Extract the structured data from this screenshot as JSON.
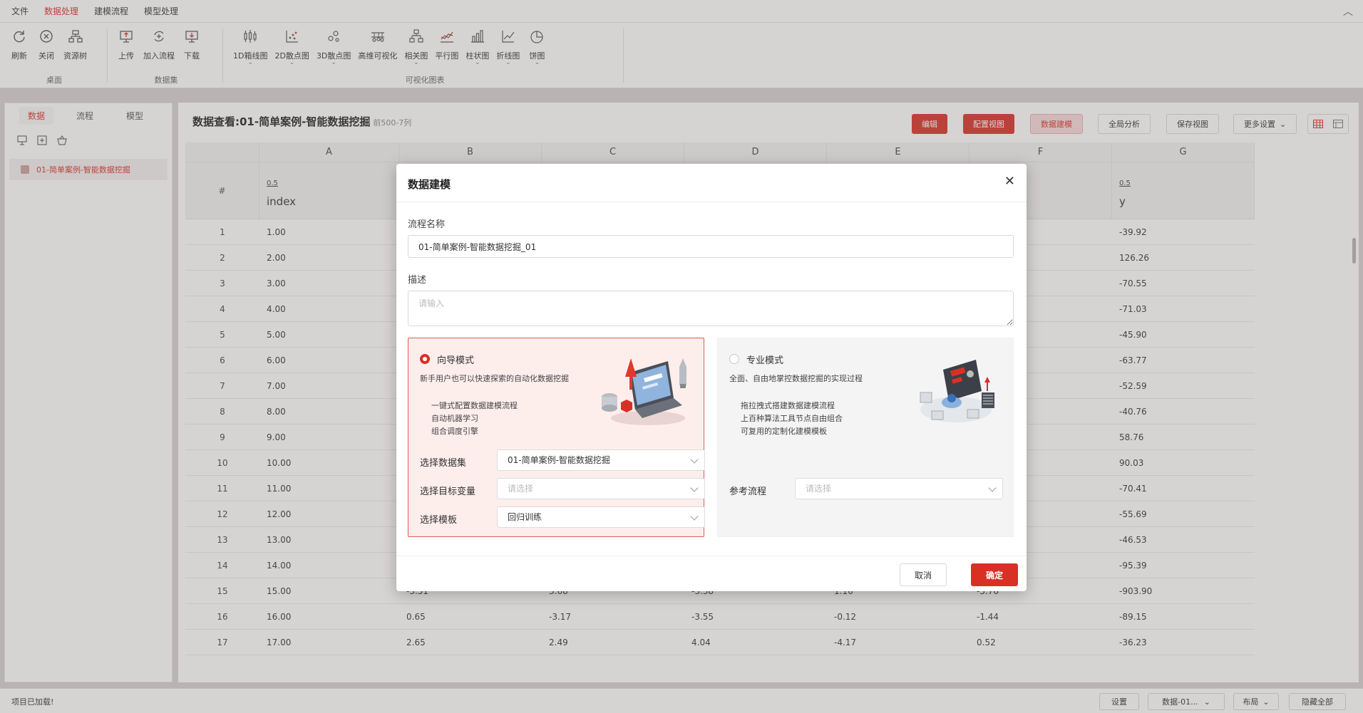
{
  "menu": {
    "items": [
      "文件",
      "数据处理",
      "建模流程",
      "模型处理"
    ],
    "active_index": 1,
    "collapse_glyph": "︿"
  },
  "ribbon": {
    "groups": [
      {
        "name": "桌面",
        "buttons": [
          {
            "label": "刷新",
            "icon": "refresh-icon"
          },
          {
            "label": "关闭",
            "icon": "close-circle-icon"
          },
          {
            "label": "资源树",
            "icon": "resource-tree-icon"
          }
        ]
      },
      {
        "name": "数据集",
        "buttons": [
          {
            "label": "上传",
            "icon": "upload-icon"
          },
          {
            "label": "加入流程",
            "icon": "add-to-flow-icon"
          },
          {
            "label": "下载",
            "icon": "download-icon"
          }
        ]
      },
      {
        "name": "可视化图表",
        "buttons": [
          {
            "label": "1D箱线图",
            "icon": "boxplot-icon",
            "dropdown": true
          },
          {
            "label": "2D散点图",
            "icon": "scatter-2d-icon",
            "dropdown": true
          },
          {
            "label": "3D散点图",
            "icon": "scatter-3d-icon",
            "dropdown": true
          },
          {
            "label": "高维可视化",
            "icon": "high-dim-icon"
          },
          {
            "label": "相关图",
            "icon": "correlation-icon",
            "dropdown": true
          },
          {
            "label": "平行图",
            "icon": "parallel-icon"
          },
          {
            "label": "柱状图",
            "icon": "bar-chart-icon",
            "dropdown": true
          },
          {
            "label": "折线图",
            "icon": "line-chart-icon",
            "dropdown": true
          },
          {
            "label": "饼图",
            "icon": "pie-chart-icon",
            "dropdown": true
          }
        ]
      }
    ]
  },
  "left_panel": {
    "tabs": [
      "数据",
      "流程",
      "模型"
    ],
    "active_tab": 0,
    "tools": [
      "monitor-icon",
      "add-box-icon",
      "basket-icon"
    ],
    "tree_item": "01-简单案例-智能数据挖掘"
  },
  "main": {
    "title": "数据查看:01-简单案例-智能数据挖掘",
    "subtitle": "前500-7列",
    "buttons": {
      "edit": "编辑",
      "config_view": "配置视图",
      "data_model": "数据建模",
      "global_analysis": "全局分析",
      "save_view": "保存视图",
      "more_settings": "更多设置"
    },
    "columns": [
      "A",
      "B",
      "C",
      "D",
      "E",
      "F",
      "G"
    ],
    "hash": "#",
    "field_a": {
      "meta": "0.5",
      "name": "index"
    },
    "field_g": {
      "meta": "0.5",
      "name": "y"
    },
    "rows": [
      {
        "n": "1",
        "a": "1.00",
        "b": "",
        "c": "",
        "d": "",
        "e": "",
        "f": "",
        "g": "-39.92"
      },
      {
        "n": "2",
        "a": "2.00",
        "b": "",
        "c": "",
        "d": "",
        "e": "",
        "f": "",
        "g": "126.26"
      },
      {
        "n": "3",
        "a": "3.00",
        "b": "",
        "c": "",
        "d": "",
        "e": "",
        "f": "",
        "g": "-70.55"
      },
      {
        "n": "4",
        "a": "4.00",
        "b": "",
        "c": "",
        "d": "",
        "e": "",
        "f": "",
        "g": "-71.03"
      },
      {
        "n": "5",
        "a": "5.00",
        "b": "",
        "c": "",
        "d": "",
        "e": "",
        "f": "",
        "g": "-45.90"
      },
      {
        "n": "6",
        "a": "6.00",
        "b": "",
        "c": "",
        "d": "",
        "e": "",
        "f": "",
        "g": "-63.77"
      },
      {
        "n": "7",
        "a": "7.00",
        "b": "",
        "c": "",
        "d": "",
        "e": "",
        "f": "",
        "g": "-52.59"
      },
      {
        "n": "8",
        "a": "8.00",
        "b": "",
        "c": "",
        "d": "",
        "e": "",
        "f": "",
        "g": "-40.76"
      },
      {
        "n": "9",
        "a": "9.00",
        "b": "",
        "c": "",
        "d": "",
        "e": "",
        "f": "",
        "g": "58.76"
      },
      {
        "n": "10",
        "a": "10.00",
        "b": "",
        "c": "",
        "d": "",
        "e": "",
        "f": "",
        "g": "90.03"
      },
      {
        "n": "11",
        "a": "11.00",
        "b": "",
        "c": "",
        "d": "",
        "e": "",
        "f": "",
        "g": "-70.41"
      },
      {
        "n": "12",
        "a": "12.00",
        "b": "",
        "c": "",
        "d": "",
        "e": "",
        "f": "",
        "g": "-55.69"
      },
      {
        "n": "13",
        "a": "13.00",
        "b": "",
        "c": "",
        "d": "",
        "e": "",
        "f": "",
        "g": "-46.53"
      },
      {
        "n": "14",
        "a": "14.00",
        "b": "",
        "c": "",
        "d": "",
        "e": "",
        "f": "",
        "g": "-95.39"
      },
      {
        "n": "15",
        "a": "15.00",
        "b": "-3.51",
        "c": "3.68",
        "d": "-3.38",
        "e": "1.16",
        "f": "-3.76",
        "g": "-903.90"
      },
      {
        "n": "16",
        "a": "16.00",
        "b": "0.65",
        "c": "-3.17",
        "d": "-3.55",
        "e": "-0.12",
        "f": "-1.44",
        "g": "-89.15"
      },
      {
        "n": "17",
        "a": "17.00",
        "b": "2.65",
        "c": "2.49",
        "d": "4.04",
        "e": "-4.17",
        "f": "0.52",
        "g": "-36.23"
      }
    ]
  },
  "status": {
    "text": "项目已加载!",
    "buttons": {
      "settings": "设置",
      "dataset": "数据-01...",
      "layout": "布局",
      "hide_all": "隐藏全部"
    }
  },
  "modal": {
    "title": "数据建模",
    "close_glyph": "✕",
    "flow_name_label": "流程名称",
    "flow_name_value": "01-简单案例-智能数据挖掘_01",
    "desc_label": "描述",
    "desc_placeholder": "请输入",
    "guide": {
      "title": "向导模式",
      "desc": "新手用户也可以快速探索的自动化数据挖掘",
      "features": [
        "一键式配置数据建模流程",
        "自动机器学习",
        "组合调度引擎"
      ],
      "dataset_label": "选择数据集",
      "dataset_value": "01-简单案例-智能数据挖掘",
      "target_label": "选择目标变量",
      "target_placeholder": "请选择",
      "template_label": "选择模板",
      "template_value": "回归训练"
    },
    "pro": {
      "title": "专业模式",
      "desc": "全面、自由地掌控数据挖掘的实现过程",
      "features": [
        "拖拉拽式搭建数据建模流程",
        "上百种算法工具节点自由组合",
        "可复用的定制化建模模板"
      ],
      "ref_label": "参考流程",
      "ref_placeholder": "请选择"
    },
    "cancel": "取消",
    "ok": "确定"
  }
}
